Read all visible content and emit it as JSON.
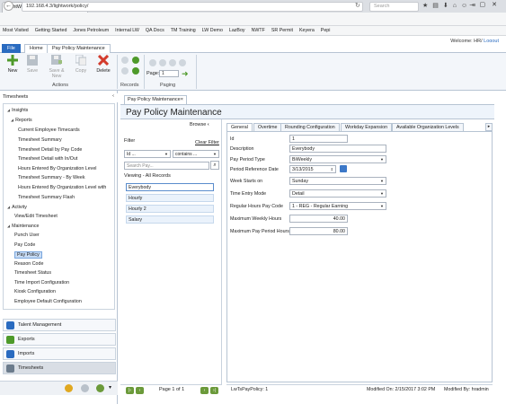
{
  "browser": {
    "tab_title": "LightWork",
    "url": "192.168.4.3/lightwork/policy/",
    "search_placeholder": "Search",
    "bookmarks": [
      "Most Visited",
      "Getting Started",
      "Jones Petroleum",
      "Internal LW",
      "QA Docs",
      "TM Training",
      "LW Demo",
      "LazBoy",
      "NWTF",
      "SR Permit",
      "Keyera",
      "Pepi"
    ]
  },
  "app": {
    "ribbon_tabs": [
      "File",
      "Home",
      "Pay Policy Maintenance"
    ],
    "welcome": "Welcome: HR/",
    "logout": "Logout",
    "actions": {
      "new": "New",
      "save": "Save",
      "save_new": "Save & New",
      "copy": "Copy",
      "delete": "Delete",
      "group": "Actions"
    },
    "records_group": "Records",
    "paging": {
      "page_label": "Page:",
      "page_value": "1",
      "group": "Paging"
    }
  },
  "left": {
    "header": "Timesheets",
    "tree": [
      {
        "label": "Insights",
        "indent": 1,
        "tri": true
      },
      {
        "label": "Reports",
        "indent": 2,
        "tri": true
      },
      {
        "label": "Current Employee Timecards",
        "indent": 4
      },
      {
        "label": "Timesheet Summary",
        "indent": 4
      },
      {
        "label": "Timesheet Detail by Pay Code",
        "indent": 4
      },
      {
        "label": "Timesheet Detail with In/Out",
        "indent": 4
      },
      {
        "label": "Hours Entered By Organization Level",
        "indent": 4
      },
      {
        "label": "Timesheet Summary - By Week",
        "indent": 4
      },
      {
        "label": "Hours Entered By Organization Level with",
        "indent": 4
      },
      {
        "label": "Timesheet Summary Flash",
        "indent": 4
      },
      {
        "label": "Activity",
        "indent": 1,
        "tri": true
      },
      {
        "label": "View/Edit Timesheet",
        "indent": 3
      },
      {
        "label": "Maintenance",
        "indent": 1,
        "tri": true
      },
      {
        "label": "Punch User",
        "indent": 3
      },
      {
        "label": "Pay Code",
        "indent": 3
      },
      {
        "label": "Pay Policy",
        "indent": 3,
        "selected": true
      },
      {
        "label": "Reason Code",
        "indent": 3
      },
      {
        "label": "Timesheet Status",
        "indent": 3
      },
      {
        "label": "Time Import Configuration",
        "indent": 3
      },
      {
        "label": "Kiosk Configuration",
        "indent": 3
      },
      {
        "label": "Employee Default Configuration",
        "indent": 3
      }
    ],
    "nav": [
      "Talent Management",
      "Exports",
      "Imports",
      "Timesheets"
    ]
  },
  "main": {
    "tab": "Pay Policy Maintenance",
    "title": "Pay Policy Maintenance",
    "browse": "Browse",
    "filter": "Filter",
    "clear_filter": "Clear Filter",
    "filter_field": "Id ...",
    "filter_op": "contains ...",
    "search_placeholder": "Search Pay...",
    "viewing": "Viewing - All Records",
    "records": [
      "Everybody",
      "Hourly",
      "Hourly 2",
      "Salary"
    ],
    "page_text": "Page 1 of 1"
  },
  "detail": {
    "tabs": [
      "General",
      "Overtime",
      "Rounding Configuration",
      "Workday Expansion",
      "Available Organization Levels"
    ],
    "fields": [
      {
        "label": "Id",
        "value": "1"
      },
      {
        "label": "Description",
        "value": "Everybody"
      },
      {
        "label": "Pay Period Type",
        "value": "BiWeekly"
      },
      {
        "label": "Period Reference Date",
        "value": "3/13/2015"
      },
      {
        "label": "Week Starts on",
        "value": "Sunday"
      },
      {
        "label": "Time Entry Mode",
        "value": "Detail"
      },
      {
        "label": "Regular Hours Pay Code",
        "value": "1 - REG - Regular Earning"
      },
      {
        "label": "Maximum Weekly Hours",
        "value": "40.00"
      },
      {
        "label": "Maximum Pay Period Hours",
        "value": "80.00"
      }
    ],
    "status_left": "LwTsPayPolicy: 1",
    "modified_on": "Modified On: 2/15/2017 3:02 PM",
    "modified_by": "Modified By: hradmin"
  },
  "colors": {
    "accent": "#2a6bc0",
    "green": "#6b9a3a",
    "delete_red": "#d33b2c"
  }
}
